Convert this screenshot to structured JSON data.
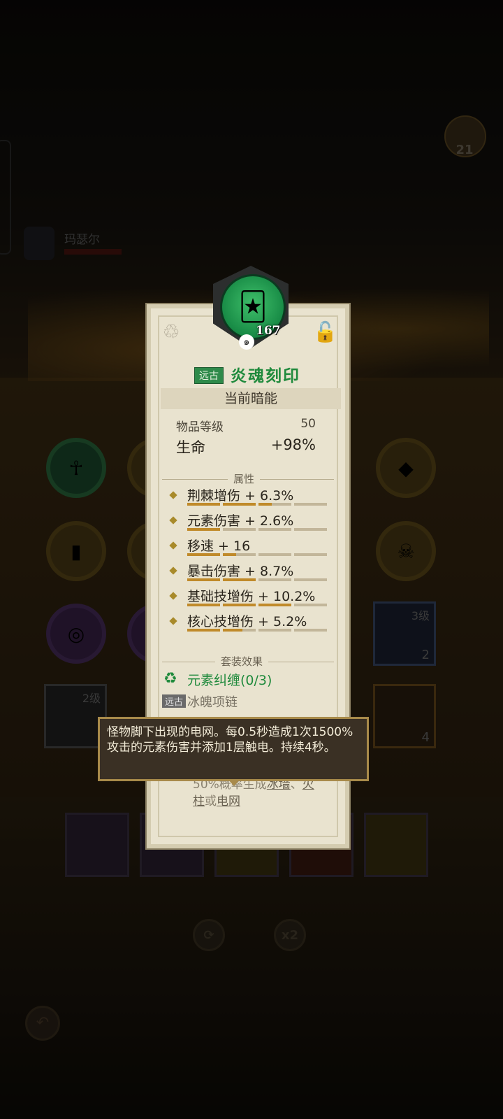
{
  "top": {
    "chest_count": "21",
    "hero_name": "玛瑟尔"
  },
  "item": {
    "level_badge": "167",
    "rarity": "远古",
    "name": "炎魂刻印",
    "section_title": "当前暗能",
    "stats": [
      {
        "label": "物品等级",
        "value": "50"
      },
      {
        "label": "生命",
        "value": "+98%"
      }
    ],
    "attr_header": "属性",
    "attributes": [
      {
        "text": "荆棘增伤 + 6.3%",
        "fill": 0.6
      },
      {
        "text": "元素伤害 + 2.6%",
        "fill": 0.25
      },
      {
        "text": "移速 + 16",
        "fill": 0.35
      },
      {
        "text": "暴击伤害 + 8.7%",
        "fill": 0.5
      },
      {
        "text": "基础技增伤 + 10.2%",
        "fill": 0.75
      },
      {
        "text": "核心技增伤 + 5.2%",
        "fill": 0.4
      }
    ],
    "set_header": "套装效果",
    "set_name": "元素纠缠(0/3)",
    "set_piece_badge": "远古",
    "set_piece_name": "冰魄项链",
    "effect_partial_line1": "50%概率生成",
    "effect_link1": "冰墙",
    "effect_sep": "、",
    "effect_link2_a": "火",
    "effect_link2_b": "柱",
    "effect_or": "或",
    "effect_link3": "电网"
  },
  "tooltip": {
    "text": "怪物脚下出现的电网。每0.5秒造成1次1500%攻击的元素伤害并添加1层触电。持续4秒。"
  },
  "inventory": {
    "right_slot_level": "3级",
    "right_slot_count": "2",
    "left_slot_level": "2级",
    "bottom_right_count": "4"
  },
  "bottom": {
    "x2_label": "x2"
  }
}
